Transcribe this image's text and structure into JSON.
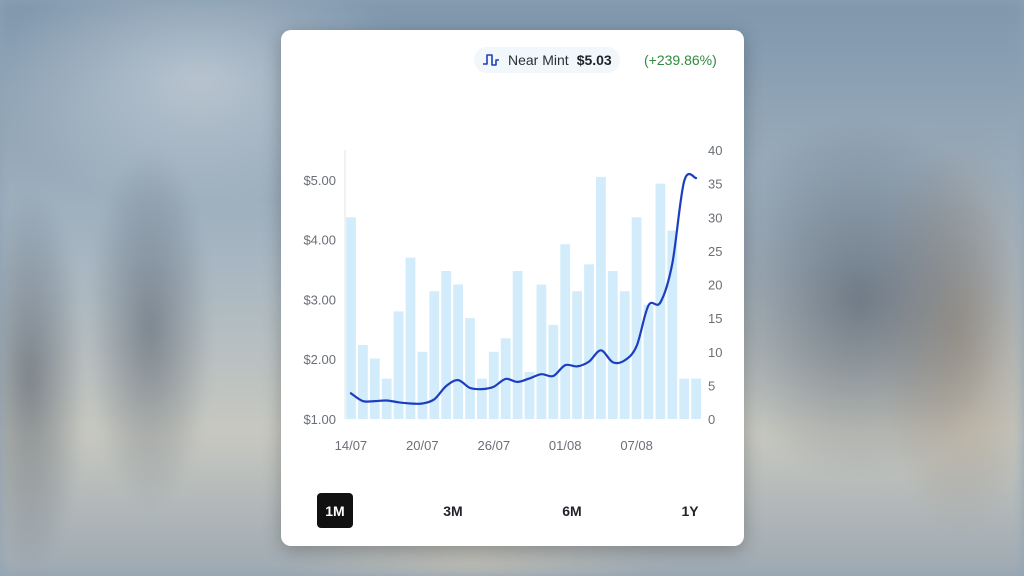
{
  "price_badge": {
    "icon": "line-chart-icon",
    "condition_label": "Near Mint",
    "price": "$5.03",
    "change": "(+239.86%)"
  },
  "chart_data": {
    "type": "bar+line",
    "categories": [
      "14/07",
      "15/07",
      "16/07",
      "17/07",
      "18/07",
      "19/07",
      "20/07",
      "21/07",
      "22/07",
      "23/07",
      "24/07",
      "25/07",
      "26/07",
      "27/07",
      "28/07",
      "29/07",
      "30/07",
      "31/07",
      "01/08",
      "02/08",
      "03/08",
      "04/08",
      "05/08",
      "06/08",
      "07/08",
      "08/08",
      "09/08",
      "10/08",
      "11/08",
      "12/08"
    ],
    "x_tick_labels": [
      "14/07",
      "20/07",
      "26/07",
      "01/08",
      "07/08"
    ],
    "series": [
      {
        "kind": "bar",
        "axis": "right",
        "values": [
          30,
          11,
          9,
          6,
          16,
          24,
          10,
          19,
          22,
          20,
          15,
          6,
          10,
          12,
          22,
          7,
          20,
          14,
          26,
          19,
          23,
          36,
          22,
          19,
          30,
          17,
          35,
          28,
          6,
          6
        ]
      },
      {
        "kind": "line",
        "axis": "left",
        "values": [
          1.43,
          1.3,
          1.3,
          1.31,
          1.28,
          1.26,
          1.26,
          1.33,
          1.55,
          1.65,
          1.52,
          1.5,
          1.54,
          1.67,
          1.62,
          1.68,
          1.75,
          1.72,
          1.9,
          1.88,
          1.96,
          2.15,
          1.95,
          1.98,
          2.22,
          2.9,
          2.95,
          3.6,
          4.98,
          5.03
        ]
      }
    ],
    "y_left": {
      "range": [
        1.0,
        5.5
      ],
      "ticks": [
        "$1.00",
        "$2.00",
        "$3.00",
        "$4.00",
        "$5.00"
      ],
      "tick_values": [
        1,
        2,
        3,
        4,
        5
      ]
    },
    "y_right": {
      "range": [
        0,
        40
      ],
      "ticks": [
        "0",
        "5",
        "10",
        "15",
        "20",
        "25",
        "30",
        "35",
        "40"
      ],
      "tick_values": [
        0,
        5,
        10,
        15,
        20,
        25,
        30,
        35,
        40
      ]
    },
    "colors": {
      "bar": "#d3ecfb",
      "line": "#1c3fbf"
    },
    "grid": false
  },
  "ranges": [
    {
      "label": "1M",
      "active": true
    },
    {
      "label": "3M",
      "active": false
    },
    {
      "label": "6M",
      "active": false
    },
    {
      "label": "1Y",
      "active": false
    }
  ]
}
